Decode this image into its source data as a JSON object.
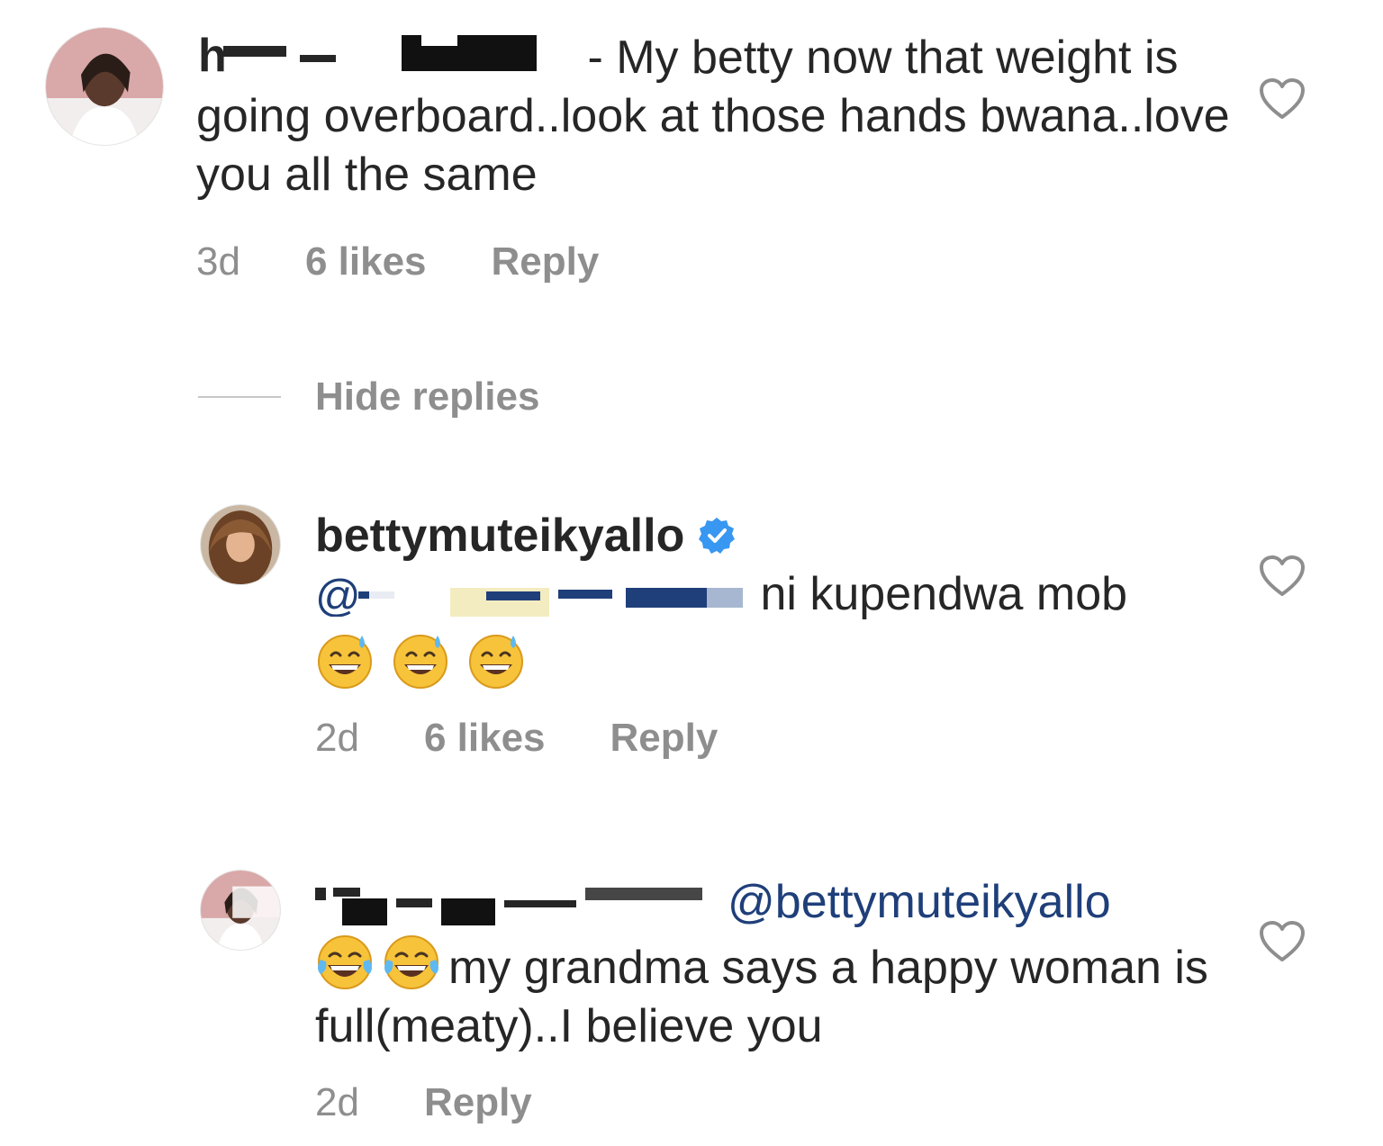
{
  "comments": [
    {
      "text": "- My betty now that weight is going overboard..look at those hands bwana..love you all the same",
      "time": "3d",
      "likes": "6 likes",
      "reply": "Reply"
    },
    {
      "username": "bettymuteikyallo",
      "text": "ni kupendwa mob",
      "emoji_icons": [
        "grinning-sweat-emoji",
        "grinning-sweat-emoji",
        "grinning-sweat-emoji"
      ],
      "time": "2d",
      "likes": "6 likes",
      "reply": "Reply"
    },
    {
      "mention": "@bettymuteikyallo",
      "text": "my grandma says a happy woman is full(meaty)..I believe you",
      "emoji_icons": [
        "tears-of-joy-emoji",
        "tears-of-joy-emoji"
      ],
      "time": "2d",
      "reply": "Reply"
    }
  ],
  "replies_toggle": "Hide replies",
  "colors": {
    "text": "#262626",
    "meta": "#8e8e8e",
    "mention": "#1f3f7a",
    "verified": "#3897f0"
  }
}
